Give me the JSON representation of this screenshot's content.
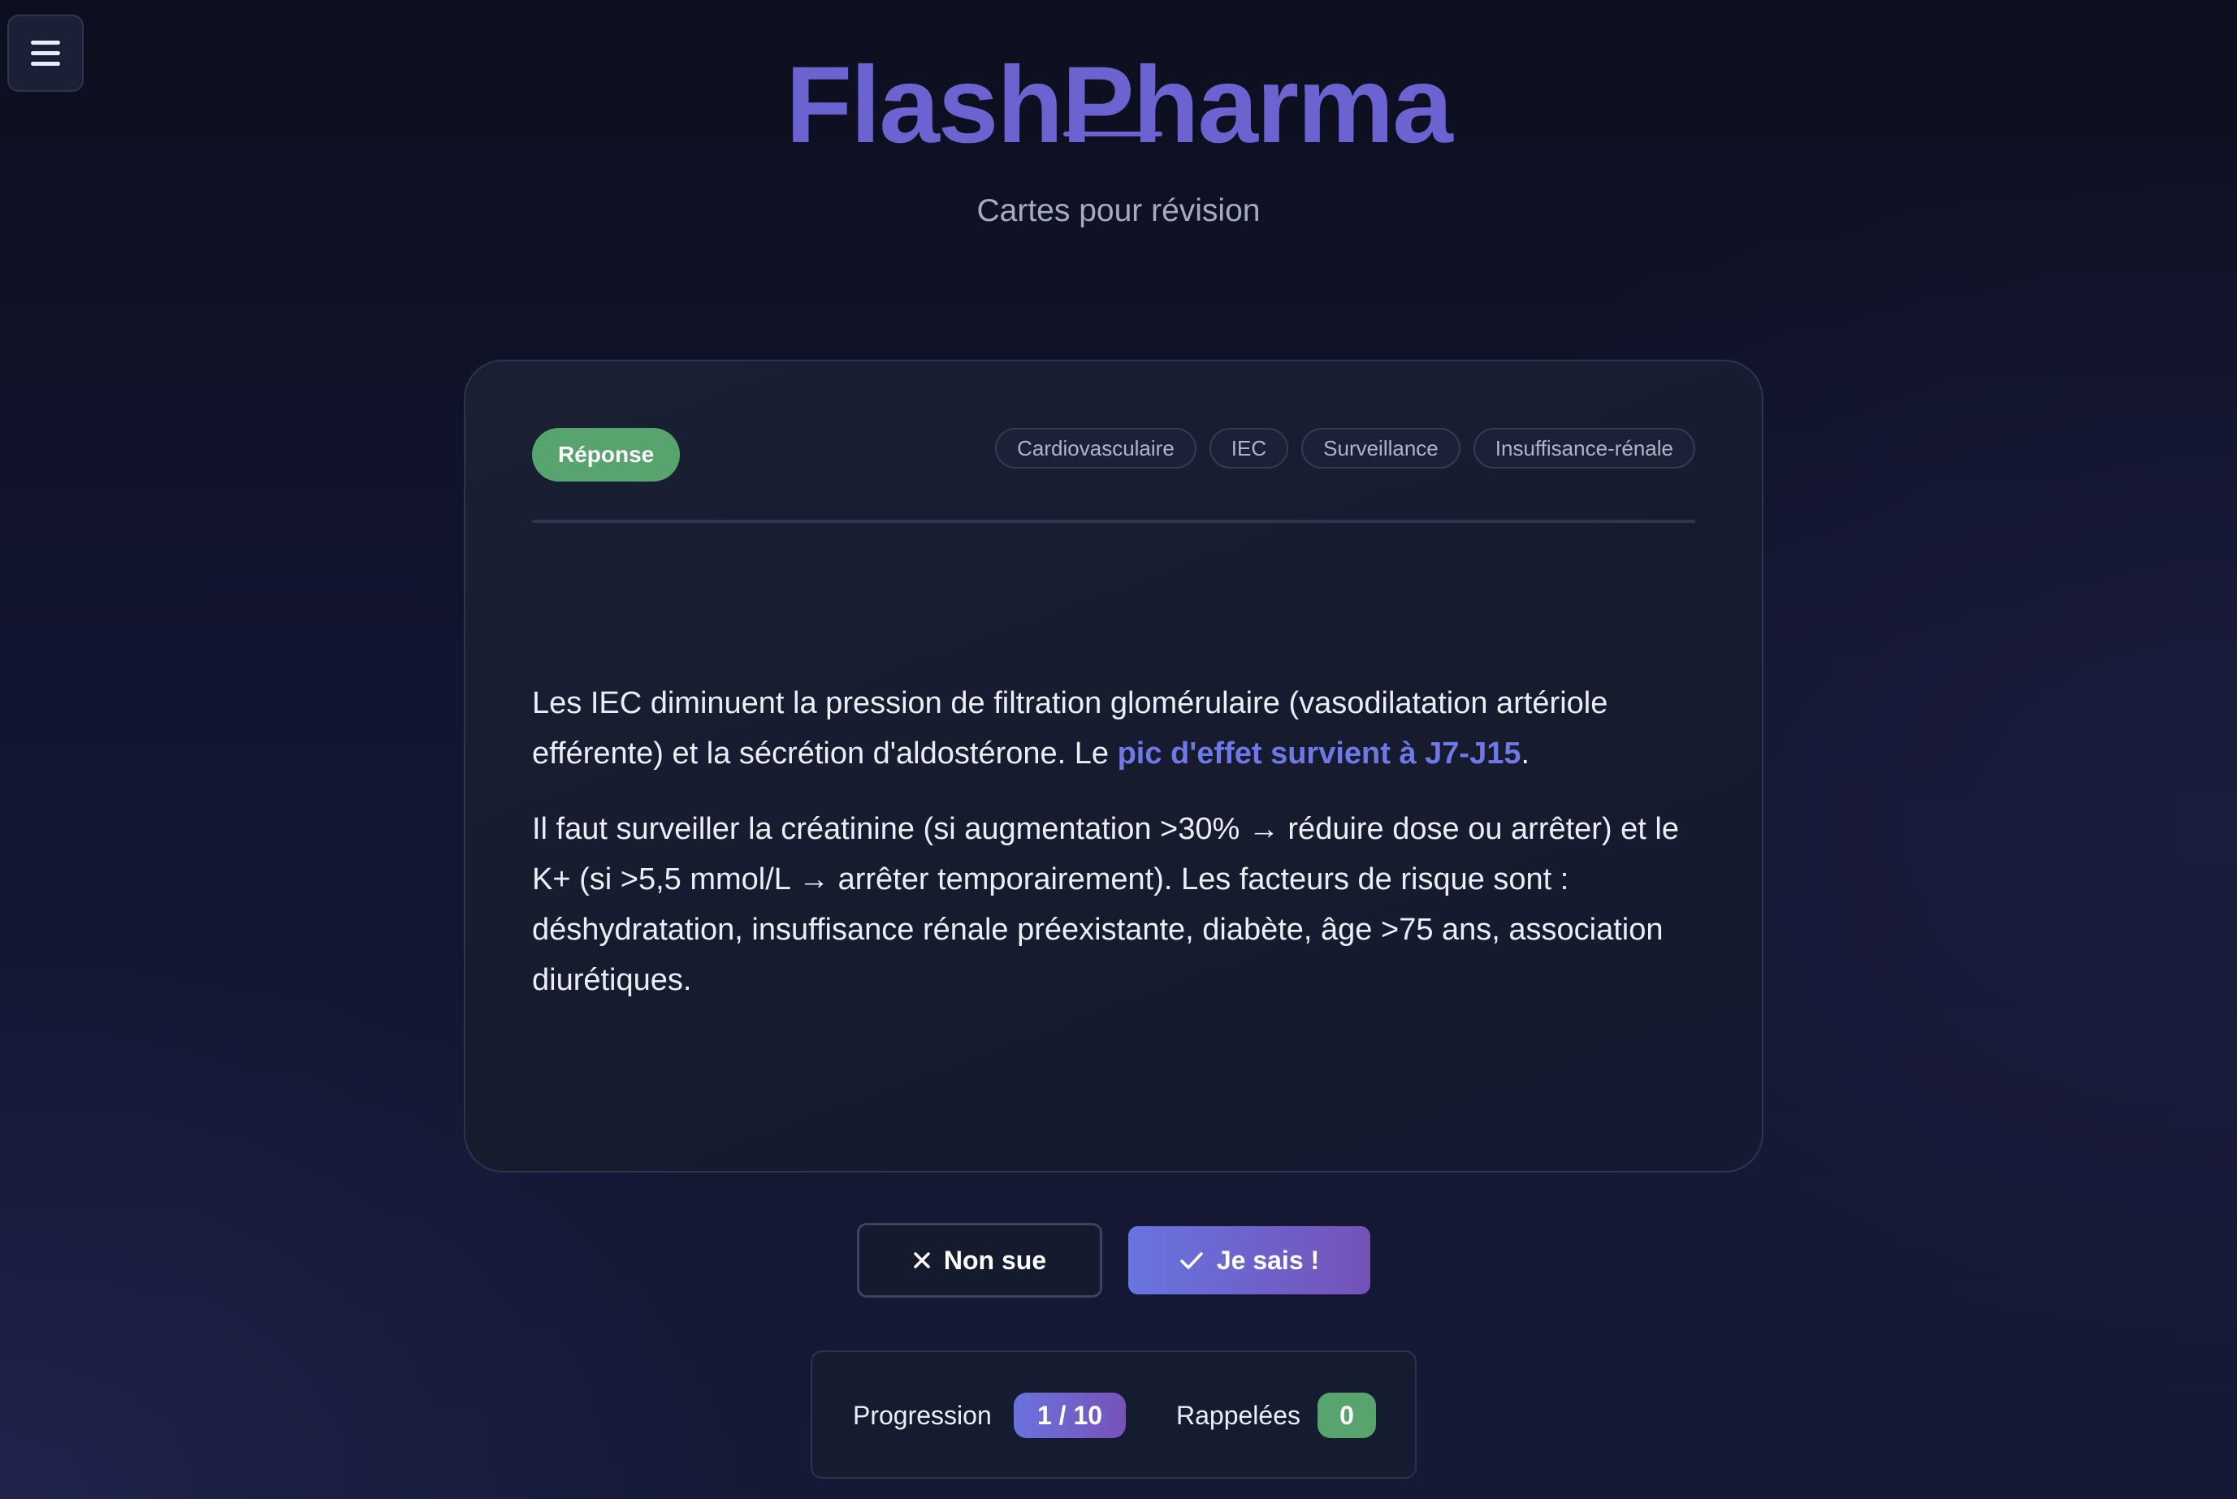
{
  "app": {
    "title": "FlashPharma",
    "subtitle": "Cartes pour révision"
  },
  "menu": {
    "icon": "hamburger-menu-icon"
  },
  "card": {
    "side_label": "Réponse",
    "tags": [
      "Cardiovasculaire",
      "IEC",
      "Surveillance",
      "Insuffisance-rénale"
    ],
    "paragraph1": {
      "text_before": "Les IEC diminuent la pression de filtration glomérulaire (vasodilatation artériole efférente) et la sécrétion d'aldostérone. Le ",
      "highlight": "pic d'effet survient à J7-J15",
      "text_after": "."
    },
    "paragraph2": "Il faut surveiller la créatinine (si augmentation >30% → réduire dose ou arrêter) et le K+ (si >5,5 mmol/L → arrêter temporairement). Les facteurs de risque sont : déshydratation, insuffisance rénale préexistante, diabète, âge >75 ans, association diurétiques."
  },
  "actions": {
    "unknown_label": "Non sue",
    "unknown_icon": "close-icon",
    "known_label": "Je sais !",
    "known_icon": "check-icon"
  },
  "stats": {
    "progress_label": "Progression",
    "progress_value": "1 / 10",
    "recalled_label": "Rappelées",
    "recalled_value": "0"
  },
  "colors": {
    "accent": "#6b63d0",
    "success": "#58a46e",
    "highlight": "#6f78e6",
    "background": "#121530"
  }
}
